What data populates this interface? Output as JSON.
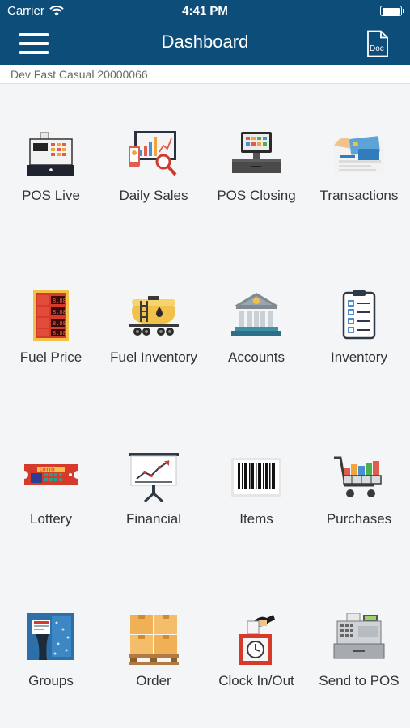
{
  "status_bar": {
    "carrier": "Carrier",
    "time": "4:41 PM",
    "battery_level": 1.0
  },
  "nav": {
    "title": "Dashboard",
    "menu_icon": "hamburger-icon",
    "doc_icon": "doc-icon",
    "doc_label": "Doc"
  },
  "store": {
    "name": "Dev Fast Casual 20000066"
  },
  "colors": {
    "header": "#0d4d7a",
    "background": "#f4f5f7",
    "label": "#333333"
  },
  "tiles": [
    {
      "label": "POS Live",
      "icon": "cash-register-icon"
    },
    {
      "label": "Daily Sales",
      "icon": "sales-report-icon"
    },
    {
      "label": "POS Closing",
      "icon": "pos-terminal-icon"
    },
    {
      "label": "Transactions",
      "icon": "credit-card-icon"
    },
    {
      "label": "Fuel Price",
      "icon": "fuel-price-board-icon"
    },
    {
      "label": "Fuel Inventory",
      "icon": "fuel-tanker-icon"
    },
    {
      "label": "Accounts",
      "icon": "bank-icon"
    },
    {
      "label": "Inventory",
      "icon": "clipboard-checklist-icon"
    },
    {
      "label": "Lottery",
      "icon": "lotto-ticket-icon"
    },
    {
      "label": "Financial",
      "icon": "growth-chart-icon"
    },
    {
      "label": "Items",
      "icon": "barcode-icon"
    },
    {
      "label": "Purchases",
      "icon": "shopping-cart-icon"
    },
    {
      "label": "Groups",
      "icon": "groups-icon"
    },
    {
      "label": "Order",
      "icon": "pallet-boxes-icon"
    },
    {
      "label": "Clock In/Out",
      "icon": "time-clock-icon"
    },
    {
      "label": "Send to POS",
      "icon": "register-printer-icon"
    }
  ]
}
